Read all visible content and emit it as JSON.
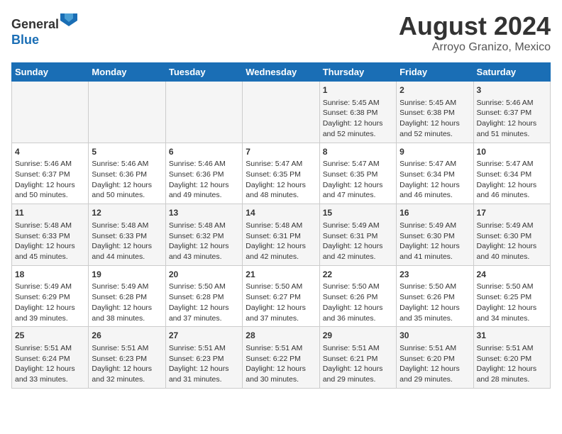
{
  "header": {
    "logo_line1": "General",
    "logo_line2": "Blue",
    "title": "August 2024",
    "subtitle": "Arroyo Granizo, Mexico"
  },
  "days_of_week": [
    "Sunday",
    "Monday",
    "Tuesday",
    "Wednesday",
    "Thursday",
    "Friday",
    "Saturday"
  ],
  "weeks": [
    [
      {
        "day": "",
        "info": ""
      },
      {
        "day": "",
        "info": ""
      },
      {
        "day": "",
        "info": ""
      },
      {
        "day": "",
        "info": ""
      },
      {
        "day": "1",
        "info": "Sunrise: 5:45 AM\nSunset: 6:38 PM\nDaylight: 12 hours\nand 52 minutes."
      },
      {
        "day": "2",
        "info": "Sunrise: 5:45 AM\nSunset: 6:38 PM\nDaylight: 12 hours\nand 52 minutes."
      },
      {
        "day": "3",
        "info": "Sunrise: 5:46 AM\nSunset: 6:37 PM\nDaylight: 12 hours\nand 51 minutes."
      }
    ],
    [
      {
        "day": "4",
        "info": "Sunrise: 5:46 AM\nSunset: 6:37 PM\nDaylight: 12 hours\nand 50 minutes."
      },
      {
        "day": "5",
        "info": "Sunrise: 5:46 AM\nSunset: 6:36 PM\nDaylight: 12 hours\nand 50 minutes."
      },
      {
        "day": "6",
        "info": "Sunrise: 5:46 AM\nSunset: 6:36 PM\nDaylight: 12 hours\nand 49 minutes."
      },
      {
        "day": "7",
        "info": "Sunrise: 5:47 AM\nSunset: 6:35 PM\nDaylight: 12 hours\nand 48 minutes."
      },
      {
        "day": "8",
        "info": "Sunrise: 5:47 AM\nSunset: 6:35 PM\nDaylight: 12 hours\nand 47 minutes."
      },
      {
        "day": "9",
        "info": "Sunrise: 5:47 AM\nSunset: 6:34 PM\nDaylight: 12 hours\nand 46 minutes."
      },
      {
        "day": "10",
        "info": "Sunrise: 5:47 AM\nSunset: 6:34 PM\nDaylight: 12 hours\nand 46 minutes."
      }
    ],
    [
      {
        "day": "11",
        "info": "Sunrise: 5:48 AM\nSunset: 6:33 PM\nDaylight: 12 hours\nand 45 minutes."
      },
      {
        "day": "12",
        "info": "Sunrise: 5:48 AM\nSunset: 6:33 PM\nDaylight: 12 hours\nand 44 minutes."
      },
      {
        "day": "13",
        "info": "Sunrise: 5:48 AM\nSunset: 6:32 PM\nDaylight: 12 hours\nand 43 minutes."
      },
      {
        "day": "14",
        "info": "Sunrise: 5:48 AM\nSunset: 6:31 PM\nDaylight: 12 hours\nand 42 minutes."
      },
      {
        "day": "15",
        "info": "Sunrise: 5:49 AM\nSunset: 6:31 PM\nDaylight: 12 hours\nand 42 minutes."
      },
      {
        "day": "16",
        "info": "Sunrise: 5:49 AM\nSunset: 6:30 PM\nDaylight: 12 hours\nand 41 minutes."
      },
      {
        "day": "17",
        "info": "Sunrise: 5:49 AM\nSunset: 6:30 PM\nDaylight: 12 hours\nand 40 minutes."
      }
    ],
    [
      {
        "day": "18",
        "info": "Sunrise: 5:49 AM\nSunset: 6:29 PM\nDaylight: 12 hours\nand 39 minutes."
      },
      {
        "day": "19",
        "info": "Sunrise: 5:49 AM\nSunset: 6:28 PM\nDaylight: 12 hours\nand 38 minutes."
      },
      {
        "day": "20",
        "info": "Sunrise: 5:50 AM\nSunset: 6:28 PM\nDaylight: 12 hours\nand 37 minutes."
      },
      {
        "day": "21",
        "info": "Sunrise: 5:50 AM\nSunset: 6:27 PM\nDaylight: 12 hours\nand 37 minutes."
      },
      {
        "day": "22",
        "info": "Sunrise: 5:50 AM\nSunset: 6:26 PM\nDaylight: 12 hours\nand 36 minutes."
      },
      {
        "day": "23",
        "info": "Sunrise: 5:50 AM\nSunset: 6:26 PM\nDaylight: 12 hours\nand 35 minutes."
      },
      {
        "day": "24",
        "info": "Sunrise: 5:50 AM\nSunset: 6:25 PM\nDaylight: 12 hours\nand 34 minutes."
      }
    ],
    [
      {
        "day": "25",
        "info": "Sunrise: 5:51 AM\nSunset: 6:24 PM\nDaylight: 12 hours\nand 33 minutes."
      },
      {
        "day": "26",
        "info": "Sunrise: 5:51 AM\nSunset: 6:23 PM\nDaylight: 12 hours\nand 32 minutes."
      },
      {
        "day": "27",
        "info": "Sunrise: 5:51 AM\nSunset: 6:23 PM\nDaylight: 12 hours\nand 31 minutes."
      },
      {
        "day": "28",
        "info": "Sunrise: 5:51 AM\nSunset: 6:22 PM\nDaylight: 12 hours\nand 30 minutes."
      },
      {
        "day": "29",
        "info": "Sunrise: 5:51 AM\nSunset: 6:21 PM\nDaylight: 12 hours\nand 29 minutes."
      },
      {
        "day": "30",
        "info": "Sunrise: 5:51 AM\nSunset: 6:20 PM\nDaylight: 12 hours\nand 29 minutes."
      },
      {
        "day": "31",
        "info": "Sunrise: 5:51 AM\nSunset: 6:20 PM\nDaylight: 12 hours\nand 28 minutes."
      }
    ]
  ]
}
